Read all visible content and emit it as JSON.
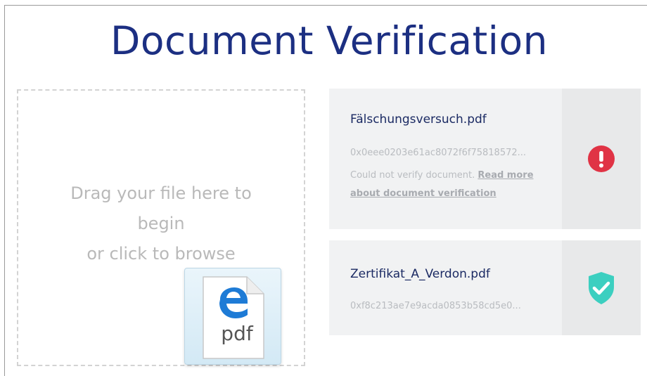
{
  "page": {
    "title": "Document Verification"
  },
  "dropzone": {
    "line1": "Drag your file here to",
    "line2": "begin",
    "line3": "or click to browse",
    "dragged_file_label": "pdf"
  },
  "files": [
    {
      "name": "Fälschungsversuch.pdf",
      "hash": "0x0eee0203e61ac8072f6f75818572...",
      "status_text": "Could not verify document. ",
      "status_link": "Read more about document verification",
      "status": "error",
      "status_icon": "error-exclamation-icon",
      "status_color": "#e03345"
    },
    {
      "name": "Zertifikat_A_Verdon.pdf",
      "hash": "0xf8c213ae7e9acda0853b58cd5e0...",
      "status": "verified",
      "status_icon": "shield-check-icon",
      "status_color": "#3ccfc0"
    }
  ],
  "colors": {
    "title": "#1c2f82",
    "card_background": "#f1f2f3",
    "status_panel_background": "#e8e9ea"
  }
}
